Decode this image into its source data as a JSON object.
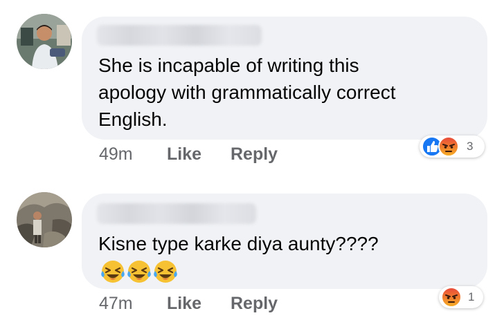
{
  "comments": [
    {
      "text_lines": [
        "She is incapable of writing this",
        "apology with grammatically correct",
        "English."
      ],
      "time": "49m",
      "like_label": "Like",
      "reply_label": "Reply",
      "reactions": [
        "like-icon",
        "angry-icon"
      ],
      "reaction_count": "3"
    },
    {
      "text_lines": [
        "Kisne type karke diya aunty????"
      ],
      "emojis": [
        "laughing-crying-icon",
        "laughing-crying-icon",
        "laughing-crying-icon"
      ],
      "time": "47m",
      "like_label": "Like",
      "reply_label": "Reply",
      "reactions": [
        "angry-icon"
      ],
      "reaction_count": "1"
    }
  ],
  "colors": {
    "bubble": "#f0f2f5",
    "text": "#050505",
    "meta": "#65676b",
    "like_blue": "#1877f2",
    "angry_orange": "#f0702a"
  }
}
